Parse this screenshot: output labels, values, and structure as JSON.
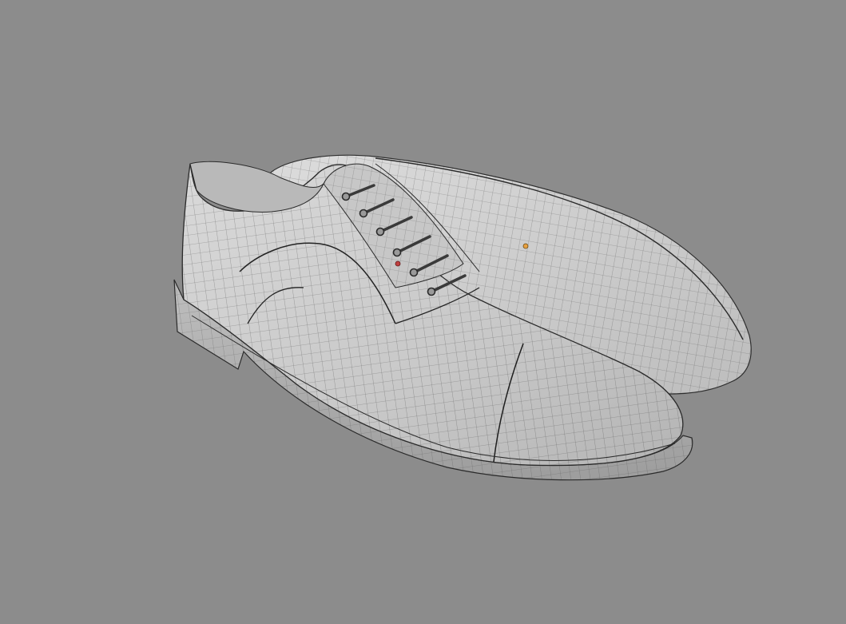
{
  "viewport": {
    "background": "#8c8c8c",
    "shading": "solid-wireframe"
  },
  "scene": {
    "objects": [
      {
        "name": "shoe-front",
        "type": "mesh",
        "wireframe": true,
        "color": "#cfcfcf"
      },
      {
        "name": "shoe-back",
        "type": "mesh",
        "wireframe": true,
        "color": "#d2d2d2"
      }
    ],
    "lace_eyelets": 6,
    "markers": [
      {
        "name": "origin-point",
        "color": "#e8a040"
      },
      {
        "name": "selected-vertex",
        "color": "#c04040"
      }
    ]
  }
}
